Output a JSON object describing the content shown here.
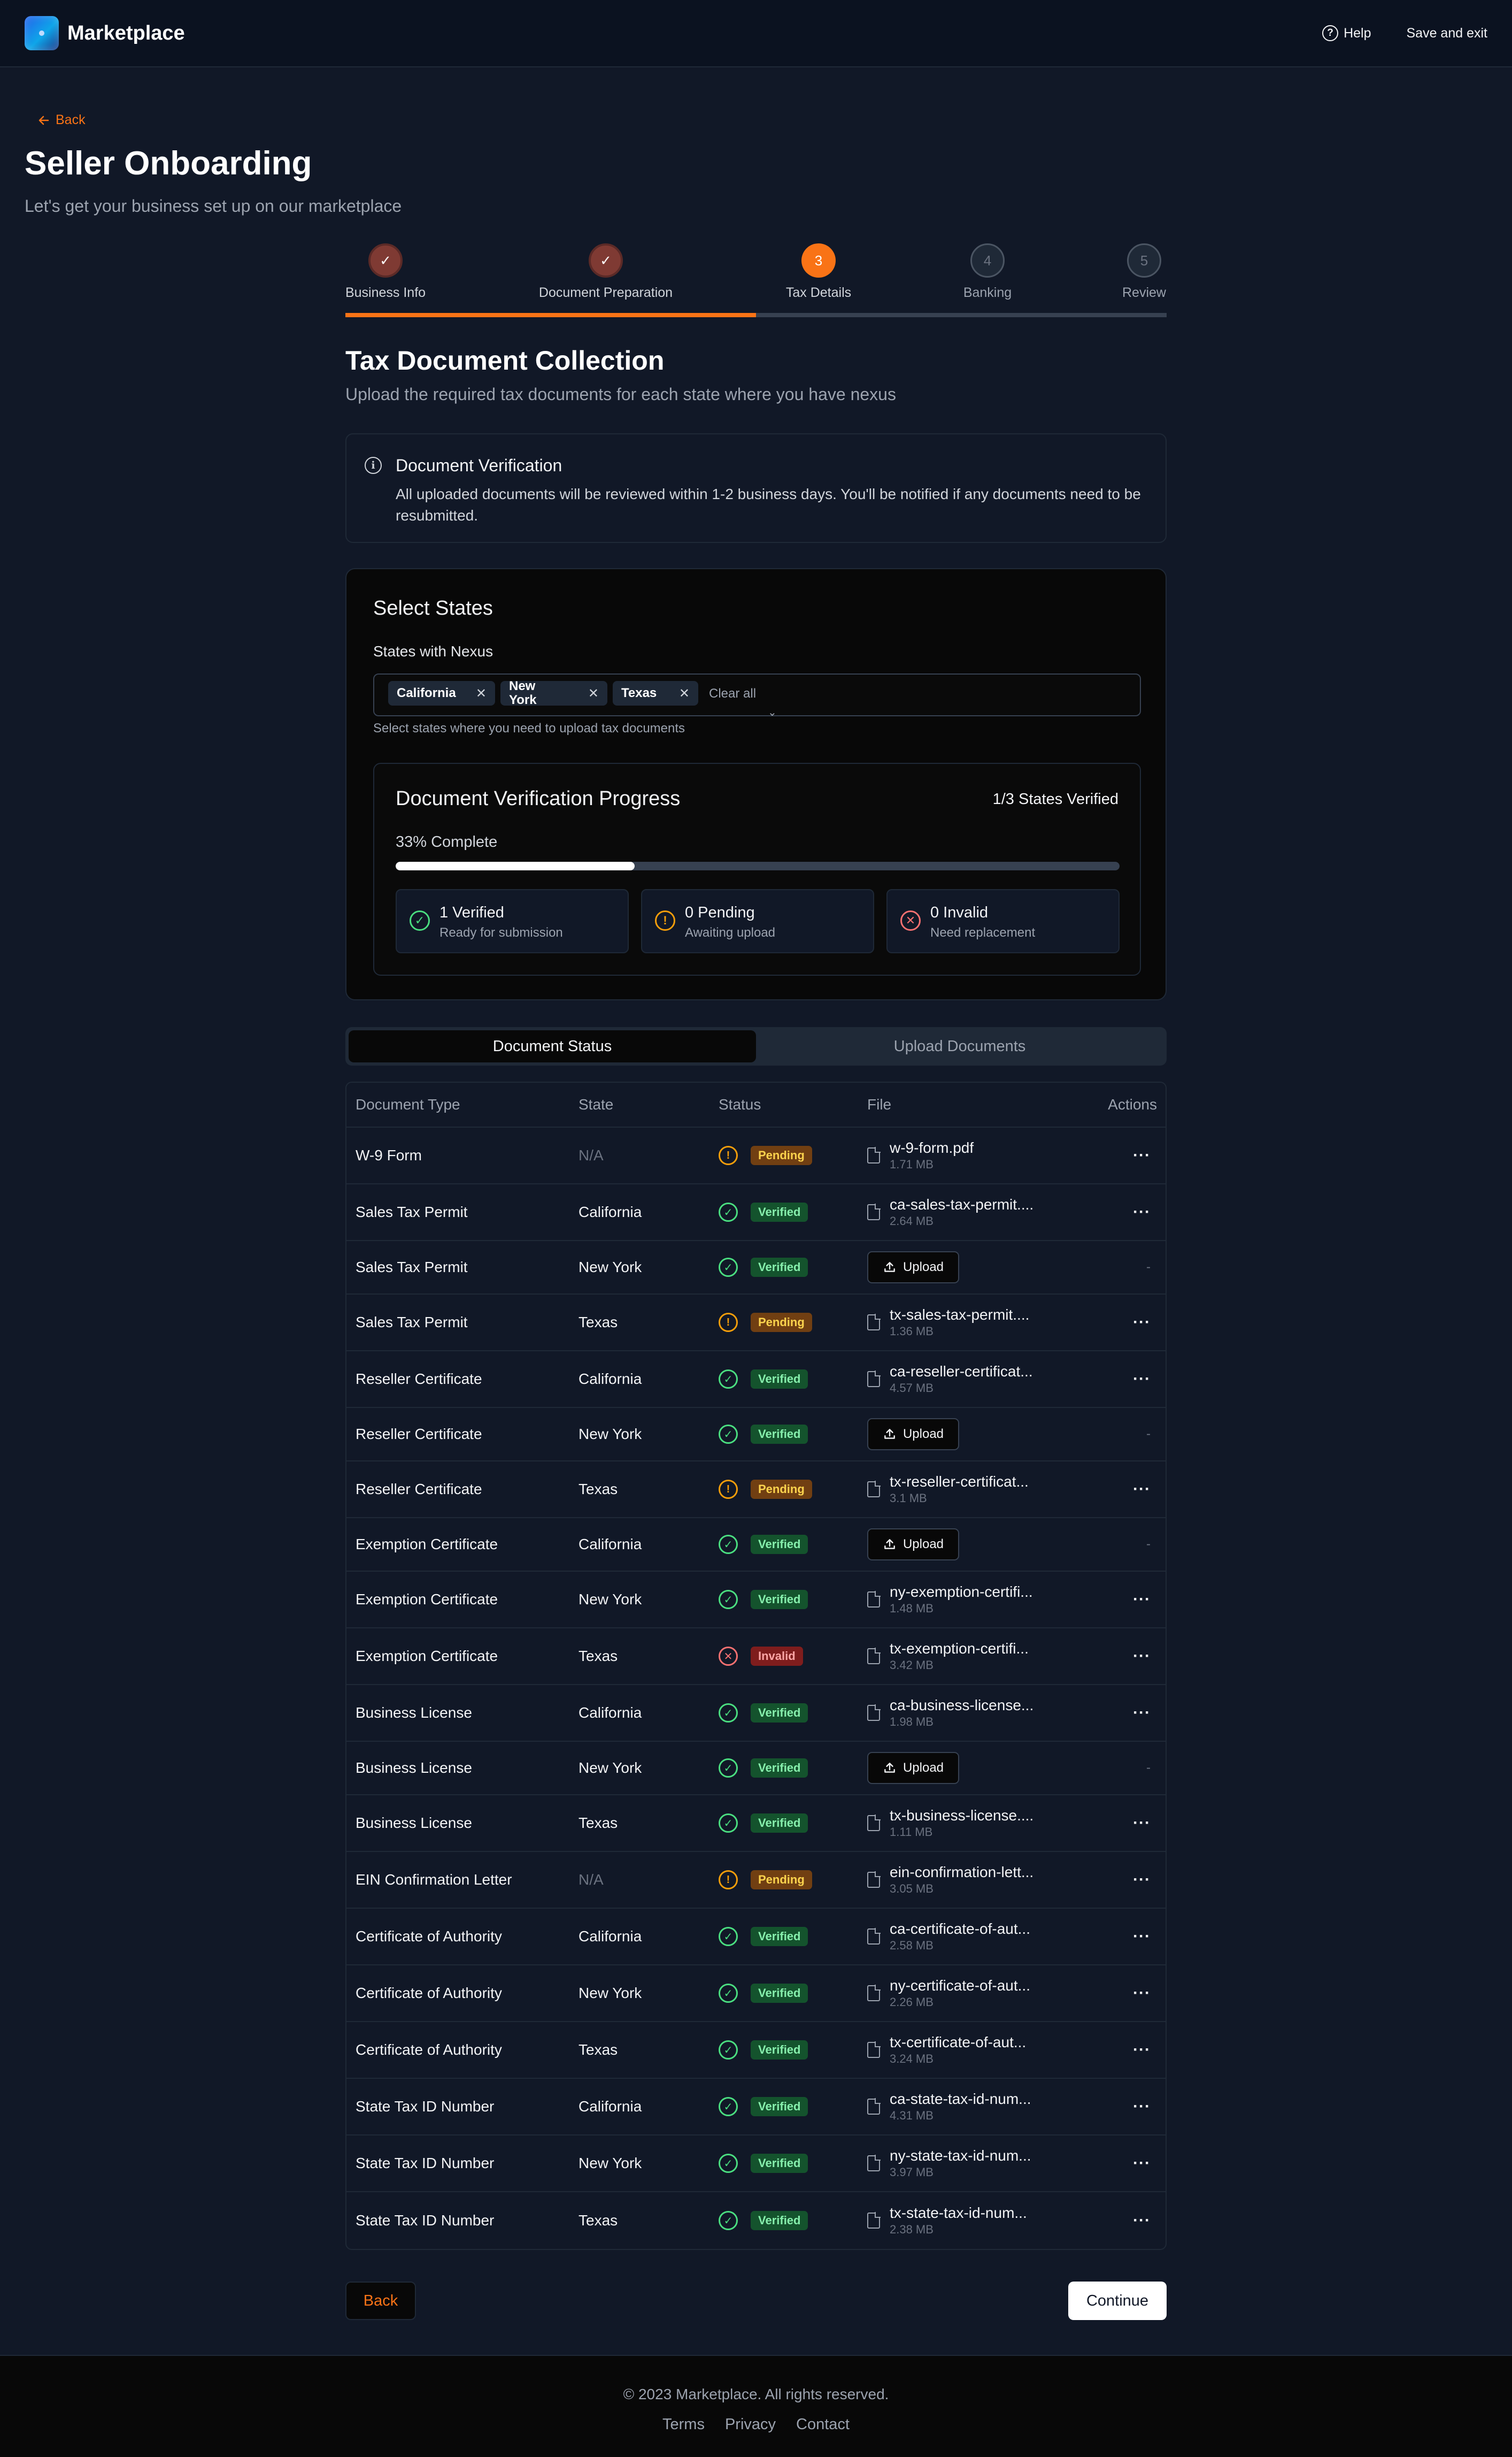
{
  "header": {
    "brand": "Marketplace",
    "help": "Help",
    "save_exit": "Save and exit"
  },
  "page": {
    "back": "Back",
    "title": "Seller Onboarding",
    "subtitle": "Let's get your business set up on our marketplace"
  },
  "stepper": {
    "progress_fraction": 0.5,
    "steps": [
      {
        "label": "Business Info",
        "state": "done",
        "number": "1"
      },
      {
        "label": "Document Preparation",
        "state": "done",
        "number": "2"
      },
      {
        "label": "Tax Details",
        "state": "active",
        "number": "3"
      },
      {
        "label": "Banking",
        "state": "todo",
        "number": "4"
      },
      {
        "label": "Review",
        "state": "todo",
        "number": "5"
      }
    ]
  },
  "section": {
    "title": "Tax Document Collection",
    "subtitle": "Upload the required tax documents for each state where you have nexus"
  },
  "alert": {
    "title": "Document Verification",
    "body": "All uploaded documents will be reviewed within 1-2 business days. You'll be notified if any documents need to be resubmitted."
  },
  "select_states": {
    "title": "Select States",
    "label": "States with Nexus",
    "chips": [
      "California",
      "New York",
      "Texas"
    ],
    "clear_all": "Clear all",
    "helper": "Select states where you need to upload tax documents"
  },
  "verification": {
    "title": "Document Verification Progress",
    "count": "1/3 States Verified",
    "percent_label": "33% Complete",
    "progress": 0.33,
    "stats": [
      {
        "main": "1 Verified",
        "sub": "Ready for submission",
        "kind": "verified",
        "color": "#4ade80"
      },
      {
        "main": "0 Pending",
        "sub": "Awaiting upload",
        "kind": "pending",
        "color": "#f59e0b"
      },
      {
        "main": "0 Invalid",
        "sub": "Need replacement",
        "kind": "invalid",
        "color": "#f87171"
      }
    ]
  },
  "tabs": [
    "Document Status",
    "Upload Documents"
  ],
  "table": {
    "headers": [
      "Document Type",
      "State",
      "Status",
      "File",
      "Actions"
    ],
    "upload_label": "Upload",
    "rows": [
      {
        "type": "W-9 Form",
        "state": "N/A",
        "status": "Pending",
        "file": "w-9-form.pdf",
        "size": "1.71 MB"
      },
      {
        "type": "Sales Tax Permit",
        "state": "California",
        "status": "Verified",
        "file": "ca-sales-tax-permit....",
        "size": "2.64 MB"
      },
      {
        "type": "Sales Tax Permit",
        "state": "New York",
        "status": "Verified",
        "file": "",
        "size": ""
      },
      {
        "type": "Sales Tax Permit",
        "state": "Texas",
        "status": "Pending",
        "file": "tx-sales-tax-permit....",
        "size": "1.36 MB"
      },
      {
        "type": "Reseller Certificate",
        "state": "California",
        "status": "Verified",
        "file": "ca-reseller-certificat...",
        "size": "4.57 MB"
      },
      {
        "type": "Reseller Certificate",
        "state": "New York",
        "status": "Verified",
        "file": "",
        "size": ""
      },
      {
        "type": "Reseller Certificate",
        "state": "Texas",
        "status": "Pending",
        "file": "tx-reseller-certificat...",
        "size": "3.1 MB"
      },
      {
        "type": "Exemption Certificate",
        "state": "California",
        "status": "Verified",
        "file": "",
        "size": ""
      },
      {
        "type": "Exemption Certificate",
        "state": "New York",
        "status": "Verified",
        "file": "ny-exemption-certifi...",
        "size": "1.48 MB"
      },
      {
        "type": "Exemption Certificate",
        "state": "Texas",
        "status": "Invalid",
        "file": "tx-exemption-certifi...",
        "size": "3.42 MB"
      },
      {
        "type": "Business License",
        "state": "California",
        "status": "Verified",
        "file": "ca-business-license...",
        "size": "1.98 MB"
      },
      {
        "type": "Business License",
        "state": "New York",
        "status": "Verified",
        "file": "",
        "size": ""
      },
      {
        "type": "Business License",
        "state": "Texas",
        "status": "Verified",
        "file": "tx-business-license....",
        "size": "1.11 MB"
      },
      {
        "type": "EIN Confirmation Letter",
        "state": "N/A",
        "status": "Pending",
        "file": "ein-confirmation-lett...",
        "size": "3.05 MB"
      },
      {
        "type": "Certificate of Authority",
        "state": "California",
        "status": "Verified",
        "file": "ca-certificate-of-aut...",
        "size": "2.58 MB"
      },
      {
        "type": "Certificate of Authority",
        "state": "New York",
        "status": "Verified",
        "file": "ny-certificate-of-aut...",
        "size": "2.26 MB"
      },
      {
        "type": "Certificate of Authority",
        "state": "Texas",
        "status": "Verified",
        "file": "tx-certificate-of-aut...",
        "size": "3.24 MB"
      },
      {
        "type": "State Tax ID Number",
        "state": "California",
        "status": "Verified",
        "file": "ca-state-tax-id-num...",
        "size": "4.31 MB"
      },
      {
        "type": "State Tax ID Number",
        "state": "New York",
        "status": "Verified",
        "file": "ny-state-tax-id-num...",
        "size": "3.97 MB"
      },
      {
        "type": "State Tax ID Number",
        "state": "Texas",
        "status": "Verified",
        "file": "tx-state-tax-id-num...",
        "size": "2.38 MB"
      }
    ]
  },
  "actions": {
    "back": "Back",
    "continue": "Continue"
  },
  "footer": {
    "copyright": "© 2023 Marketplace. All rights reserved.",
    "links": [
      "Terms",
      "Privacy",
      "Contact"
    ]
  },
  "colors": {
    "accent": "#f97316",
    "verified": "#4ade80",
    "pending": "#f59e0b",
    "invalid": "#f87171"
  }
}
